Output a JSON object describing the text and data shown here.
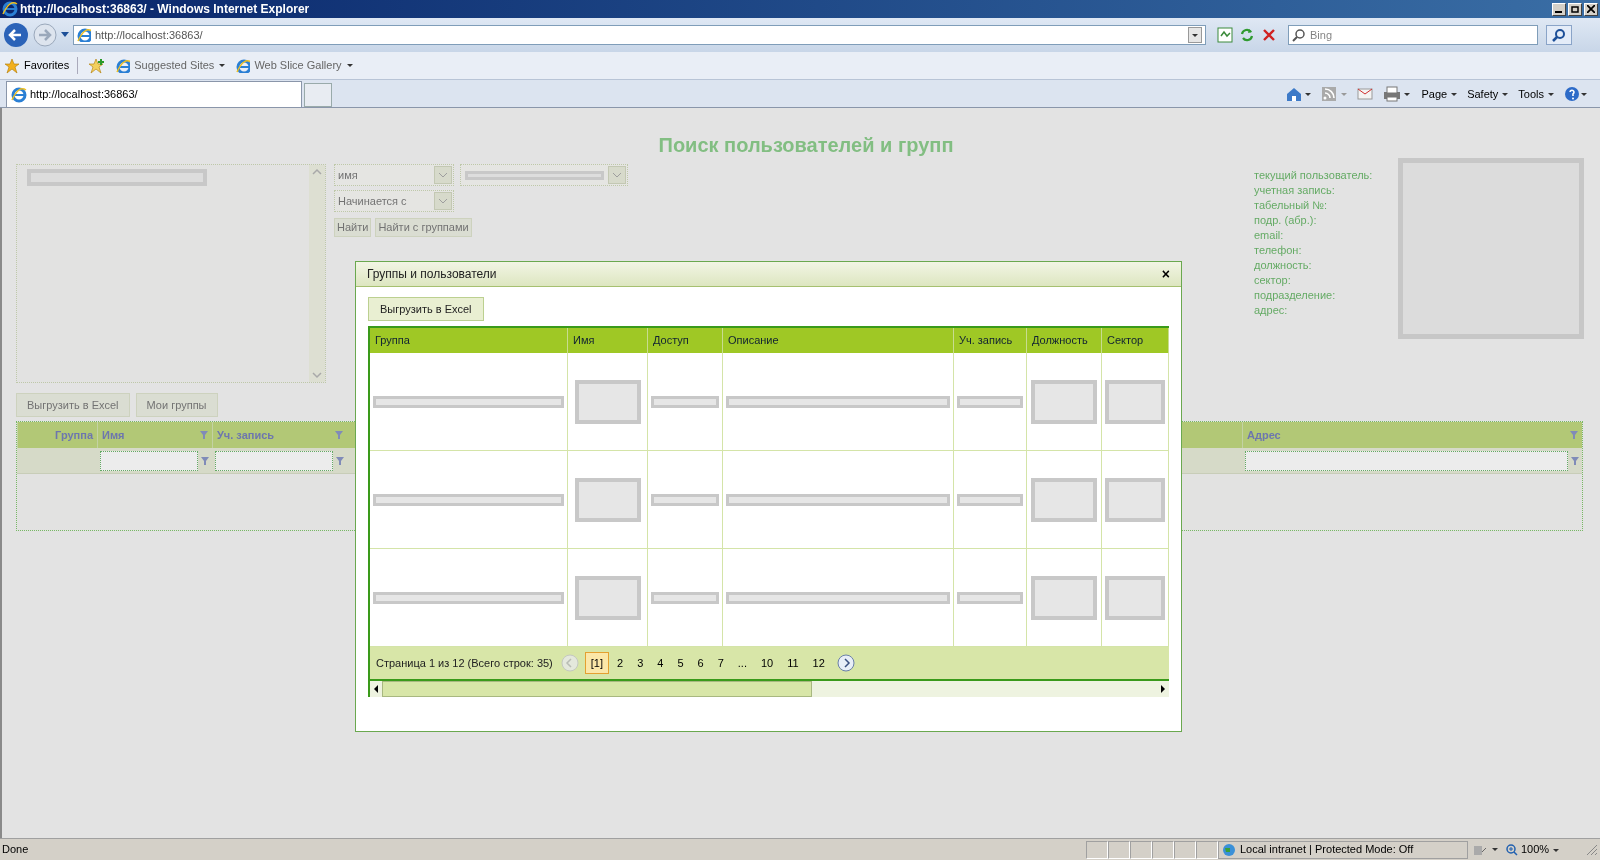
{
  "browser": {
    "title": "http://localhost:36863/ - Windows Internet Explorer",
    "address": "http://localhost:36863/",
    "search_placeholder": "Bing",
    "favorites": "Favorites",
    "links": [
      "Suggested Sites",
      "Web Slice Gallery"
    ],
    "tab": "http://localhost:36863/",
    "commands": [
      "Page",
      "Safety",
      "Tools"
    ]
  },
  "page": {
    "title": "Поиск пользователей и групп",
    "field_dropdown": "имя",
    "condition_dropdown": "Начинается с",
    "search_buttons": [
      "Найти",
      "Найти с группами"
    ],
    "grid_buttons": [
      "Выгрузить в Excel",
      "Мои группы"
    ],
    "grid_columns": [
      {
        "label": "Группа",
        "filter": false
      },
      {
        "label": "Имя",
        "filter": true
      },
      {
        "label": "Уч. запись",
        "filter": true
      },
      {
        "label": "Адрес",
        "filter": true
      }
    ],
    "user_info": [
      "текущий пользователь:",
      "учетная запись:",
      "табельный №:",
      "подр. (абр.):",
      "email:",
      "телефон:",
      "должность:",
      "сектор:",
      "подразделение:",
      "адрес:"
    ]
  },
  "dialog": {
    "title": "Группы и пользователи",
    "close": "×",
    "export_button": "Выгрузить в Excel",
    "columns": [
      "Группа",
      "Имя",
      "Доступ",
      "Описание",
      "Уч. запись",
      "Должность",
      "Сектор"
    ],
    "rows": [
      {
        "cells": [
          {
            "kind": "bar"
          },
          {
            "kind": "box"
          },
          {
            "kind": "bar"
          },
          {
            "kind": "bar"
          },
          {
            "kind": "bar"
          },
          {
            "kind": "box"
          },
          {
            "kind": "box"
          }
        ]
      },
      {
        "cells": [
          {
            "kind": "bar"
          },
          {
            "kind": "box"
          },
          {
            "kind": "bar"
          },
          {
            "kind": "bar"
          },
          {
            "kind": "bar"
          },
          {
            "kind": "box"
          },
          {
            "kind": "box"
          }
        ]
      },
      {
        "cells": [
          {
            "kind": "bar"
          },
          {
            "kind": "box"
          },
          {
            "kind": "bar"
          },
          {
            "kind": "bar"
          },
          {
            "kind": "bar"
          },
          {
            "kind": "box"
          },
          {
            "kind": "box"
          }
        ]
      }
    ],
    "pager": {
      "summary": "Страница 1 из 12 (Всего строк: 35)",
      "pages": [
        {
          "label": "[1]",
          "selected": true
        },
        {
          "label": "2",
          "selected": false
        },
        {
          "label": "3",
          "selected": false
        },
        {
          "label": "4",
          "selected": false
        },
        {
          "label": "5",
          "selected": false
        },
        {
          "label": "6",
          "selected": false
        },
        {
          "label": "7",
          "selected": false
        },
        {
          "label": "...",
          "selected": false
        },
        {
          "label": "10",
          "selected": false
        },
        {
          "label": "11",
          "selected": false
        },
        {
          "label": "12",
          "selected": false
        }
      ]
    }
  },
  "status_bar": {
    "text": "Done",
    "zone": "Local intranet | Protected Mode: Off",
    "zoom": "100%"
  }
}
